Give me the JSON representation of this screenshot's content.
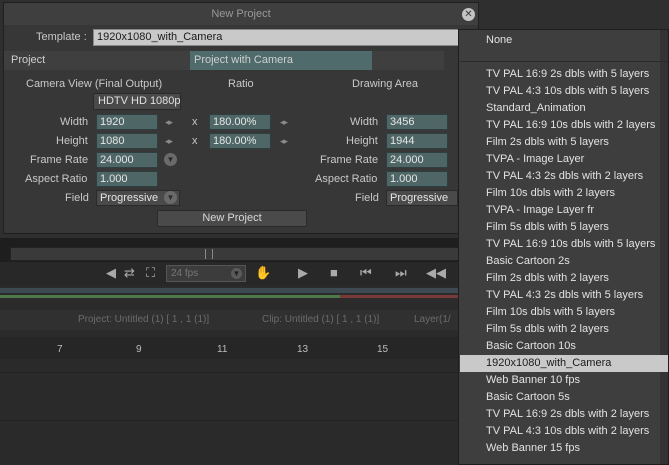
{
  "dialog": {
    "title": "New Project",
    "template_label": "Template :",
    "template_value": "1920x1080_with_Camera",
    "tabs": [
      "Project",
      "Project with Camera"
    ],
    "columns": {
      "camera_view": "Camera View (Final Output)",
      "ratio": "Ratio",
      "drawing_area": "Drawing Area"
    },
    "camera_mode": "HDTV  HD 1080p",
    "labels": {
      "width": "Width",
      "height": "Height",
      "frame_rate": "Frame Rate",
      "aspect_ratio": "Aspect Ratio",
      "field": "Field"
    },
    "camera": {
      "width": "1920",
      "height": "1080",
      "frame_rate": "24.000",
      "aspect_ratio": "1.000",
      "field": "Progressive"
    },
    "ratio": {
      "x_symbol": "x",
      "width": "180.00%",
      "height": "180.00%"
    },
    "drawing": {
      "width": "3456",
      "height": "1944",
      "frame_rate": "24.000",
      "aspect_ratio": "1.000",
      "field": "Progressive"
    },
    "new_project_button": "New Project"
  },
  "dropdown": {
    "items": [
      "None",
      "TV PAL 16:9 2s dbls with 5 layers",
      "TV PAL 4:3 10s dbls with 5 layers",
      "Standard_Animation",
      "TV PAL 16:9 10s dbls with 2 layers",
      "Film 2s dbls with 5 layers",
      "TVPA - Image Layer",
      "TV PAL 4:3 2s dbls with 2 layers",
      "Film 10s dbls with 2 layers",
      "TVPA - Image Layer fr",
      "Film 5s dbls with 5 layers",
      "TV PAL 16:9 10s dbls with 5 layers",
      "Basic Cartoon 2s",
      "Film 2s dbls with 2 layers",
      "TV PAL 4:3 2s dbls with 5 layers",
      "Film 10s dbls with 5 layers",
      "Film 5s dbls with 2 layers",
      "Basic Cartoon 10s",
      "1920x1080_with_Camera",
      "Web Banner 10 fps",
      "Basic Cartoon 5s",
      "TV PAL 16:9 2s dbls with 2 layers",
      "TV PAL 4:3 10s dbls with 2 layers",
      "Web Banner 15 fps"
    ],
    "selected": "1920x1080_with_Camera"
  },
  "background": {
    "fps": "24 fps",
    "project_info": "Project: Untitled (1) [ 1 , 1  (1)]",
    "clip_info": "Clip: Untitled (1) [ 1 , 1  (1)]",
    "layer_info": "Layer(1/",
    "frame_numbers": [
      "7",
      "9",
      "11",
      "13",
      "15"
    ]
  }
}
